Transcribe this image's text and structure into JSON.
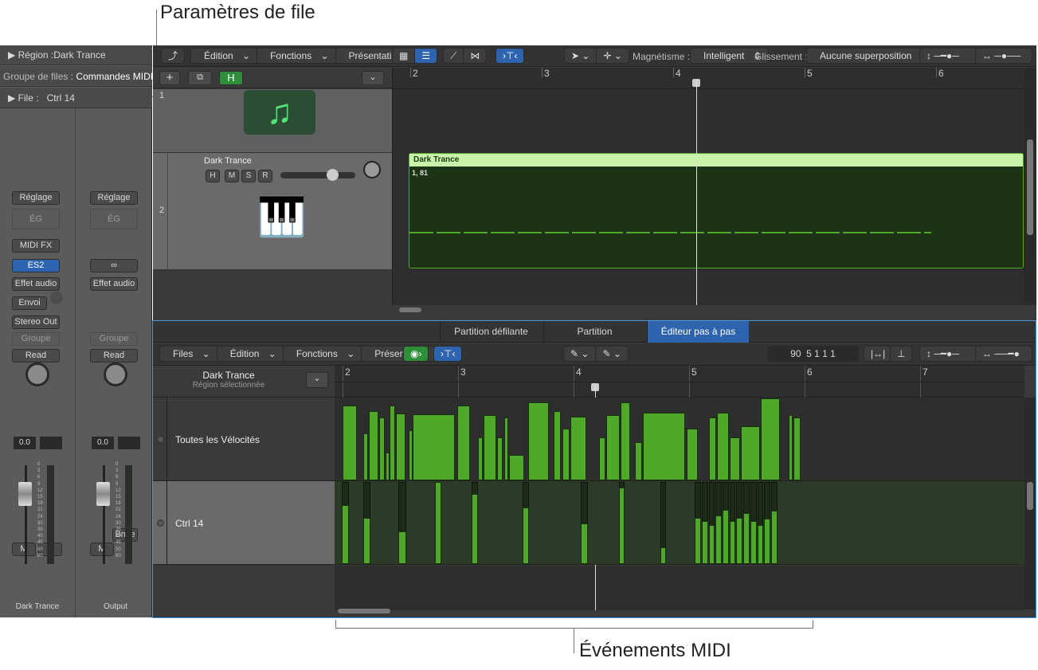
{
  "callouts": {
    "top": "Paramètres de file",
    "bottom": "Événements MIDI"
  },
  "inspector": {
    "region_label": "Région :",
    "region_name": "Dark Trance",
    "group_label": "Groupe de files :",
    "group_value": "Commandes MIDI",
    "file_label": "File :",
    "file_value": "Ctrl 14",
    "strips": [
      {
        "setting": "Réglage",
        "eq": "ÉG",
        "midi_fx": "MIDI FX",
        "instrument": "ES2",
        "audio_fx": "Effet audio",
        "send": "Envoi",
        "output": "Stereo Out",
        "group": "Groupe",
        "automation": "Read",
        "volume": "0.0",
        "mute": "M",
        "solo": "S",
        "name": "Dark Trance"
      },
      {
        "setting": "Réglage",
        "eq": "ÉG",
        "link_icon": "link-icon",
        "audio_fx": "Effet audio",
        "group": "Groupe",
        "automation": "Read",
        "volume": "0.0",
        "bounce": "Bnce",
        "mute": "M",
        "name": "Output"
      }
    ],
    "meter_scale": [
      "0",
      "3",
      "6",
      "9",
      "12",
      "15",
      "18",
      "21",
      "24",
      "30",
      "35",
      "40",
      "45",
      "50",
      "60"
    ]
  },
  "main_toolbar": {
    "menus": [
      "Édition",
      "Fonctions",
      "Présentation"
    ],
    "snap_label": "Magnétisme :",
    "snap_value": "Intelligent",
    "drag_label": "Glissement :",
    "drag_value": "Aucune superposition",
    "track_add": "+",
    "h_button": "H"
  },
  "tracks": [
    {
      "number": "1",
      "icon": "music-note-icon"
    },
    {
      "number": "2",
      "name": "Dark Trance",
      "buttons": [
        "H",
        "M",
        "S",
        "R"
      ]
    }
  ],
  "region": {
    "name": "Dark Trance",
    "info": "1, 81",
    "color": "#c8f3a8"
  },
  "ruler_top": [
    "2",
    "3",
    "4",
    "5",
    "6"
  ],
  "editor": {
    "tabs": [
      "Partition défilante",
      "Partition",
      "Éditeur pas à pas"
    ],
    "active_tab": 2,
    "menus": [
      "Files",
      "Édition",
      "Fonctions",
      "Présentation"
    ],
    "position": "90  5 1 1 1",
    "region_name": "Dark Trance",
    "region_sub": "Région sélectionnée",
    "ruler": [
      "2",
      "3",
      "4",
      "5",
      "6",
      "7"
    ],
    "lanes": [
      {
        "name": "Toutes les Vélocités",
        "events": [
          [
            2.0,
            2.13,
            116
          ],
          [
            2.18,
            2.23,
            73
          ],
          [
            2.23,
            2.32,
            107
          ],
          [
            2.32,
            2.37,
            97
          ],
          [
            2.37,
            2.41,
            43
          ],
          [
            2.41,
            2.46,
            116
          ],
          [
            2.46,
            2.55,
            104
          ],
          [
            2.57,
            2.61,
            78
          ],
          [
            2.61,
            2.98,
            102
          ],
          [
            2.99,
            3.11,
            116
          ],
          [
            3.17,
            3.22,
            67
          ],
          [
            3.22,
            3.34,
            101
          ],
          [
            3.34,
            3.39,
            66
          ],
          [
            3.4,
            3.44,
            97
          ],
          [
            3.44,
            3.58,
            40
          ],
          [
            3.61,
            3.79,
            121
          ],
          [
            3.83,
            3.9,
            107
          ],
          [
            3.9,
            3.97,
            80
          ],
          [
            3.97,
            4.12,
            99
          ],
          [
            4.22,
            4.28,
            67
          ],
          [
            4.28,
            4.41,
            101
          ],
          [
            4.41,
            4.5,
            121
          ],
          [
            4.53,
            4.6,
            59
          ],
          [
            4.6,
            4.97,
            105
          ],
          [
            4.98,
            5.08,
            80
          ],
          [
            5.17,
            5.24,
            98
          ],
          [
            5.24,
            5.35,
            105
          ],
          [
            5.35,
            5.45,
            67
          ],
          [
            5.45,
            5.62,
            84
          ],
          [
            5.62,
            5.79,
            127
          ],
          [
            5.86,
            5.9,
            101
          ],
          [
            5.9,
            5.97,
            97
          ]
        ]
      },
      {
        "name": "Ctrl 14",
        "events": [
          [
            1.99,
            2.06,
            91
          ],
          [
            2.18,
            2.25,
            72
          ],
          [
            2.48,
            2.56,
            50
          ],
          [
            2.8,
            2.86,
            127
          ],
          [
            3.12,
            3.18,
            108
          ],
          [
            3.56,
            3.62,
            88
          ],
          [
            4.06,
            4.13,
            63
          ],
          [
            4.39,
            4.45,
            118
          ],
          [
            4.75,
            4.81,
            26
          ],
          [
            5.05,
            5.11,
            72
          ],
          [
            5.11,
            5.17,
            66
          ],
          [
            5.17,
            5.23,
            60
          ],
          [
            5.23,
            5.29,
            75
          ],
          [
            5.29,
            5.35,
            84
          ],
          [
            5.35,
            5.41,
            66
          ],
          [
            5.41,
            5.47,
            72
          ],
          [
            5.47,
            5.53,
            79
          ],
          [
            5.53,
            5.59,
            66
          ],
          [
            5.59,
            5.65,
            60
          ],
          [
            5.65,
            5.71,
            70
          ],
          [
            5.71,
            5.77,
            82
          ]
        ]
      }
    ]
  },
  "colors": {
    "accent": "#2d64ad",
    "event": "#4fa82a",
    "region_bg": "#1d3316"
  }
}
